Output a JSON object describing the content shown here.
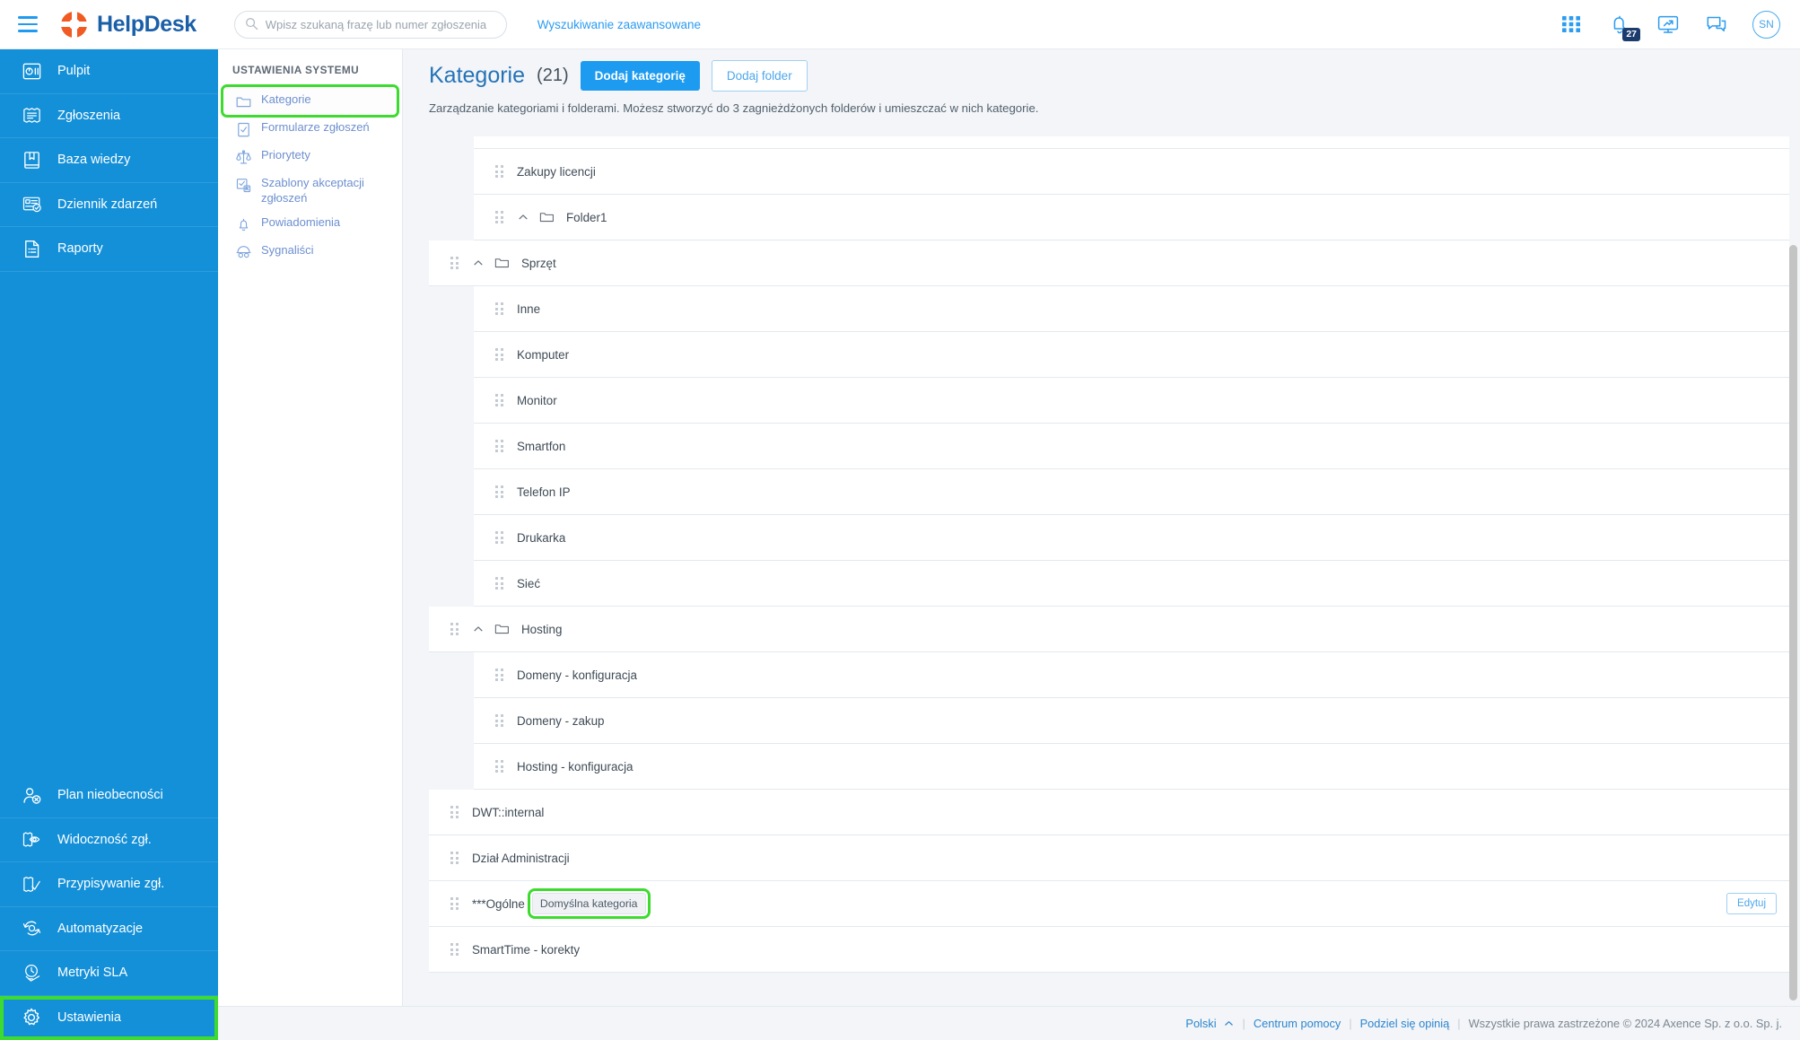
{
  "topbar": {
    "menu_icon": "hamburger-icon",
    "brand": "HelpDesk",
    "search": {
      "placeholder": "Wpisz szukaną frazę lub numer zgłoszenia",
      "value": "",
      "icon": "search-icon"
    },
    "advanced_search": "Wyszukiwanie zaawansowane",
    "icons": [
      {
        "name": "apps-grid-icon"
      },
      {
        "name": "notification-bell-icon",
        "badge": "27"
      },
      {
        "name": "remote-desktop-icon"
      },
      {
        "name": "chat-icon"
      }
    ],
    "avatar_initials": "SN"
  },
  "sidebar": {
    "top_items": [
      {
        "label": "Pulpit",
        "icon": "dashboard-icon"
      },
      {
        "label": "Zgłoszenia",
        "icon": "tickets-icon"
      },
      {
        "label": "Baza wiedzy",
        "icon": "knowledge-base-icon"
      },
      {
        "label": "Dziennik zdarzeń",
        "icon": "event-log-icon"
      },
      {
        "label": "Raporty",
        "icon": "reports-icon"
      }
    ],
    "bottom_items": [
      {
        "label": "Plan nieobecności",
        "icon": "absence-plan-icon",
        "selected": false
      },
      {
        "label": "Widoczność zgł.",
        "icon": "ticket-visibility-icon",
        "selected": false
      },
      {
        "label": "Przypisywanie zgł.",
        "icon": "ticket-assignment-icon",
        "selected": false
      },
      {
        "label": "Automatyzacje",
        "icon": "automation-icon",
        "selected": false
      },
      {
        "label": "Metryki SLA",
        "icon": "sla-metrics-icon",
        "selected": false
      },
      {
        "label": "Ustawienia",
        "icon": "settings-gear-icon",
        "selected": true
      }
    ]
  },
  "submenu": {
    "title": "USTAWIENIA SYSTEMU",
    "items": [
      {
        "label": "Kategorie",
        "icon": "folder-icon",
        "selected": true
      },
      {
        "label": "Formularze zgłoszeń",
        "icon": "form-icon",
        "selected": false
      },
      {
        "label": "Priorytety",
        "icon": "scales-icon",
        "selected": false
      },
      {
        "label": "Szablony akceptacji zgłoszeń",
        "icon": "approval-template-icon",
        "selected": false
      },
      {
        "label": "Powiadomienia",
        "icon": "bell-icon",
        "selected": false
      },
      {
        "label": "Sygnaliści",
        "icon": "whistleblower-icon",
        "selected": false
      }
    ]
  },
  "main": {
    "title": "Kategorie",
    "count": "(21)",
    "add_category_button": "Dodaj kategorię",
    "add_folder_button": "Dodaj folder",
    "description": "Zarządzanie kategoriami i folderami. Możesz stworzyć do 3 zagnieżdżonych folderów i umieszczać w nich kategorie.",
    "rows": [
      {
        "label": "",
        "type": "partial",
        "level": 1
      },
      {
        "label": "Zakupy licencji",
        "type": "category",
        "level": 1
      },
      {
        "label": "Folder1",
        "type": "folder",
        "level": 1
      },
      {
        "label": "Sprzęt",
        "type": "folder",
        "level": 0
      },
      {
        "label": "Inne",
        "type": "category",
        "level": 1
      },
      {
        "label": "Komputer",
        "type": "category",
        "level": 1
      },
      {
        "label": "Monitor",
        "type": "category",
        "level": 1
      },
      {
        "label": "Smartfon",
        "type": "category",
        "level": 1
      },
      {
        "label": "Telefon IP",
        "type": "category",
        "level": 1
      },
      {
        "label": "Drukarka",
        "type": "category",
        "level": 1
      },
      {
        "label": "Sieć",
        "type": "category",
        "level": 1
      },
      {
        "label": "Hosting",
        "type": "folder",
        "level": 0
      },
      {
        "label": "Domeny - konfiguracja",
        "type": "category",
        "level": 1
      },
      {
        "label": "Domeny - zakup",
        "type": "category",
        "level": 1
      },
      {
        "label": "Hosting - konfiguracja",
        "type": "category",
        "level": 1
      },
      {
        "label": "DWT::internal",
        "type": "category",
        "level": 0
      },
      {
        "label": "Dział Administracji",
        "type": "category",
        "level": 0
      },
      {
        "label": "***Ogólne",
        "type": "category",
        "level": 0,
        "pill": "Domyślna kategoria",
        "pill_highlighted": true,
        "edit_button": "Edytuj"
      },
      {
        "label": "SmartTime - korekty",
        "type": "category",
        "level": 0
      }
    ]
  },
  "footer": {
    "language": "Polski",
    "help_center": "Centrum pomocy",
    "feedback": "Podziel się opinią",
    "copyright": "Wszystkie prawa zastrzeżone © 2024 Axence Sp. z o.o. Sp. j."
  }
}
